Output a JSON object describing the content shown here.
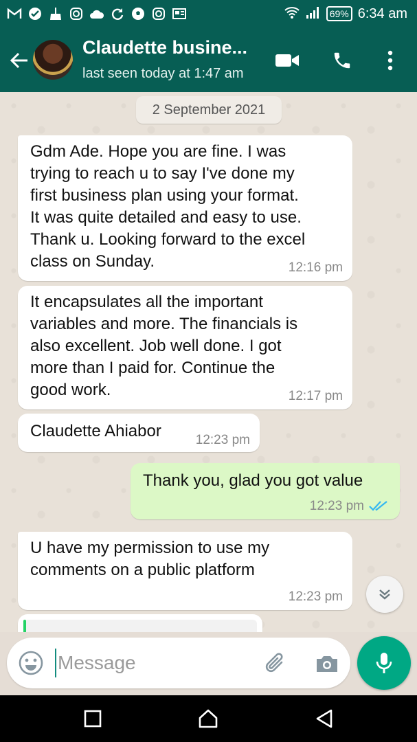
{
  "status_bar": {
    "notification_icons": [
      "gmail-icon",
      "check-circle-icon",
      "broom-icon",
      "instagram-icon",
      "cloud-icon",
      "sync-icon",
      "soccer-ball-icon",
      "instagram-icon",
      "newspaper-icon"
    ],
    "battery": "69%",
    "time": "6:34 am"
  },
  "header": {
    "contact_name": "Claudette busine...",
    "status": "last seen today at 1:47 am"
  },
  "chat": {
    "date_chip": "2 September 2021",
    "messages": [
      {
        "direction": "in",
        "text": "Gdm Ade. Hope you are fine. I was\ntrying to reach u to say I've done my\nfirst business plan using your format.\nIt was quite detailed and easy to use.\nThank u. Looking forward to the excel\nclass on Sunday.",
        "time": "12:16 pm"
      },
      {
        "direction": "in",
        "text": "It encapsulates all the important\nvariables and more. The financials is\nalso excellent. Job well done. I got\nmore than I paid for. Continue the\ngood work.",
        "time": "12:17 pm"
      },
      {
        "direction": "in",
        "text": "Claudette Ahiabor",
        "time": "12:23 pm"
      },
      {
        "direction": "out",
        "text": "Thank you, glad you got value",
        "time": "12:23 pm",
        "status": "read"
      },
      {
        "direction": "in",
        "text": "U have my permission to use my\ncomments on a public platform",
        "time": "12:23 pm"
      }
    ]
  },
  "input": {
    "placeholder": "Message"
  },
  "colors": {
    "header_bg": "#075e54",
    "outgoing_bubble": "#dcf8c6",
    "incoming_bubble": "#ffffff",
    "mic_button": "#00a884",
    "read_ticks": "#34b7f1"
  }
}
